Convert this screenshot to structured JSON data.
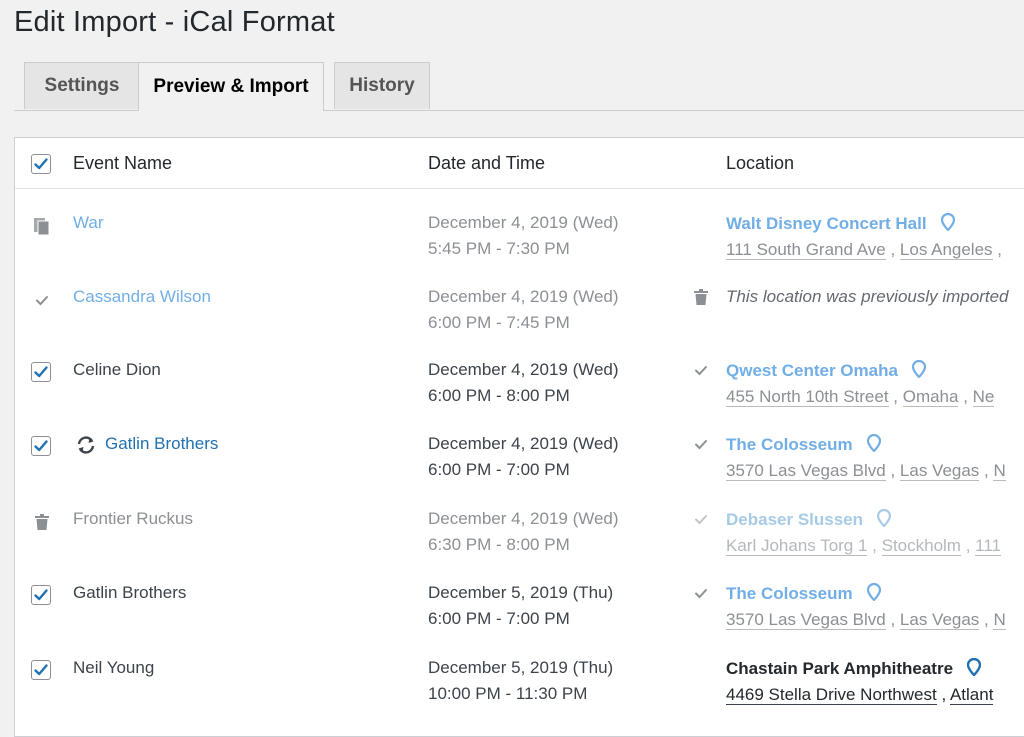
{
  "page": {
    "title": "Edit Import - iCal Format"
  },
  "tabs": [
    {
      "label": "Settings",
      "active": false
    },
    {
      "label": "Preview & Import",
      "active": true
    },
    {
      "label": "History",
      "active": false
    }
  ],
  "table": {
    "headers": {
      "event_name": "Event Name",
      "date_time": "Date and Time",
      "location": "Location"
    },
    "rows": [
      {
        "status": "duplicate-icon",
        "event": "War",
        "date": "December 4, 2019 (Wed)",
        "time": "5:45 PM - 7:30 PM",
        "location_status": "none",
        "location": "Walt Disney Concert Hall",
        "address": "111 South Grand Ave",
        "city": "Los Angeles",
        "extra": ""
      },
      {
        "status": "checkmark-icon",
        "event": "Cassandra Wilson",
        "date": "December 4, 2019 (Wed)",
        "time": "6:00 PM - 7:45 PM",
        "location_status": "trash-icon",
        "location_note": "This location was previously imported"
      },
      {
        "status": "checkbox-checked",
        "event": "Celine Dion",
        "date": "December 4, 2019 (Wed)",
        "time": "6:00 PM - 8:00 PM",
        "location_status": "checkmark-icon",
        "location": "Qwest Center Omaha",
        "address": "455 North 10th Street",
        "city": "Omaha",
        "extra": "Ne"
      },
      {
        "status": "checkbox-checked",
        "event": "Gatlin Brothers",
        "event_icon": "sync-icon",
        "date": "December 4, 2019 (Wed)",
        "time": "6:00 PM - 7:00 PM",
        "location_status": "checkmark-icon",
        "location": "The Colosseum",
        "address": "3570 Las Vegas Blvd",
        "city": "Las Vegas",
        "extra": "N"
      },
      {
        "status": "trash-icon",
        "event": "Frontier Ruckus",
        "date": "December 4, 2019 (Wed)",
        "time": "6:30 PM - 8:00 PM",
        "location_status": "checkmark-icon",
        "location": "Debaser Slussen",
        "address": "Karl Johans Torg 1",
        "city": "Stockholm",
        "extra": "111"
      },
      {
        "status": "checkbox-checked",
        "event": "Gatlin Brothers",
        "date": "December 5, 2019 (Thu)",
        "time": "6:00 PM - 7:00 PM",
        "location_status": "checkmark-icon",
        "location": "The Colosseum",
        "address": "3570 Las Vegas Blvd",
        "city": "Las Vegas",
        "extra": "N"
      },
      {
        "status": "checkbox-checked",
        "event": "Neil Young",
        "date": "December 5, 2019 (Thu)",
        "time": "10:00 PM - 11:30 PM",
        "location_status": "none",
        "location": "Chastain Park Amphitheatre",
        "address": "4469 Stella Drive Northwest",
        "city": "Atlant",
        "extra": ""
      }
    ]
  },
  "colors": {
    "link": "#2271b1",
    "link_faded": "#72aee6",
    "checkbox_blue": "#2271b1",
    "muted": "#8c8f94"
  }
}
